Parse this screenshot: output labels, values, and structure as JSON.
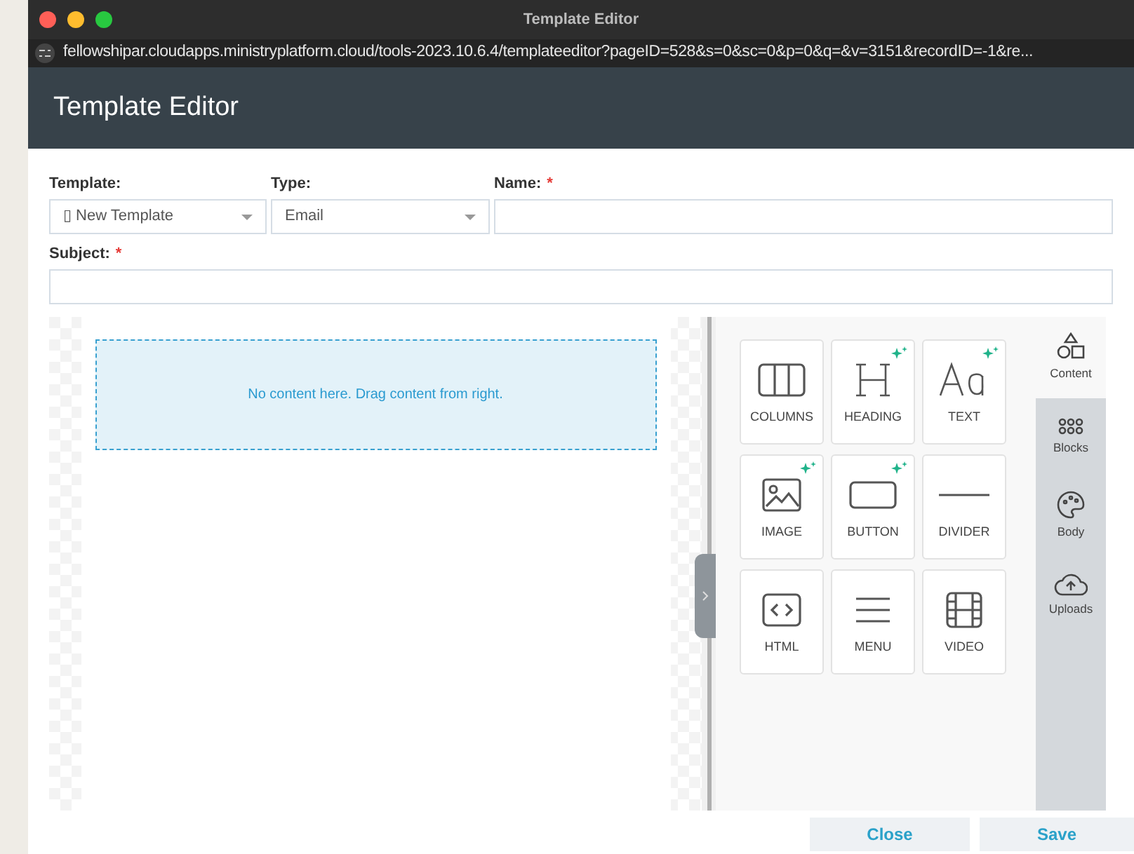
{
  "window": {
    "title": "Template Editor",
    "url": "fellowshipar.cloudapps.ministryplatform.cloud/tools-2023.10.6.4/templateeditor?pageID=528&s=0&sc=0&p=0&q=&v=3151&recordID=-1&re..."
  },
  "header": {
    "title": "Template Editor"
  },
  "form": {
    "template": {
      "label": "Template:",
      "value": "▯ New Template"
    },
    "type": {
      "label": "Type:",
      "value": "Email"
    },
    "name": {
      "label": "Name:",
      "required": true,
      "required_mark": "*"
    },
    "subject": {
      "label": "Subject:",
      "required": true,
      "required_mark": "*"
    }
  },
  "canvas": {
    "placeholder": "No content here. Drag content from right."
  },
  "tiles": [
    {
      "kind": "columns",
      "label": "COLUMNS",
      "ai": false
    },
    {
      "kind": "heading",
      "label": "HEADING",
      "ai": true
    },
    {
      "kind": "text",
      "label": "TEXT",
      "ai": true
    },
    {
      "kind": "image",
      "label": "IMAGE",
      "ai": true
    },
    {
      "kind": "button",
      "label": "BUTTON",
      "ai": true
    },
    {
      "kind": "divider",
      "label": "DIVIDER",
      "ai": false
    },
    {
      "kind": "html",
      "label": "HTML",
      "ai": false
    },
    {
      "kind": "menu",
      "label": "MENU",
      "ai": false
    },
    {
      "kind": "video",
      "label": "VIDEO",
      "ai": false
    }
  ],
  "side_tabs": [
    {
      "kind": "content",
      "label": "Content",
      "selected": true
    },
    {
      "kind": "blocks",
      "label": "Blocks",
      "selected": false
    },
    {
      "kind": "body",
      "label": "Body",
      "selected": false
    },
    {
      "kind": "uploads",
      "label": "Uploads",
      "selected": false
    }
  ],
  "buttons": [
    {
      "label": "Close"
    },
    {
      "label": "Save"
    }
  ]
}
